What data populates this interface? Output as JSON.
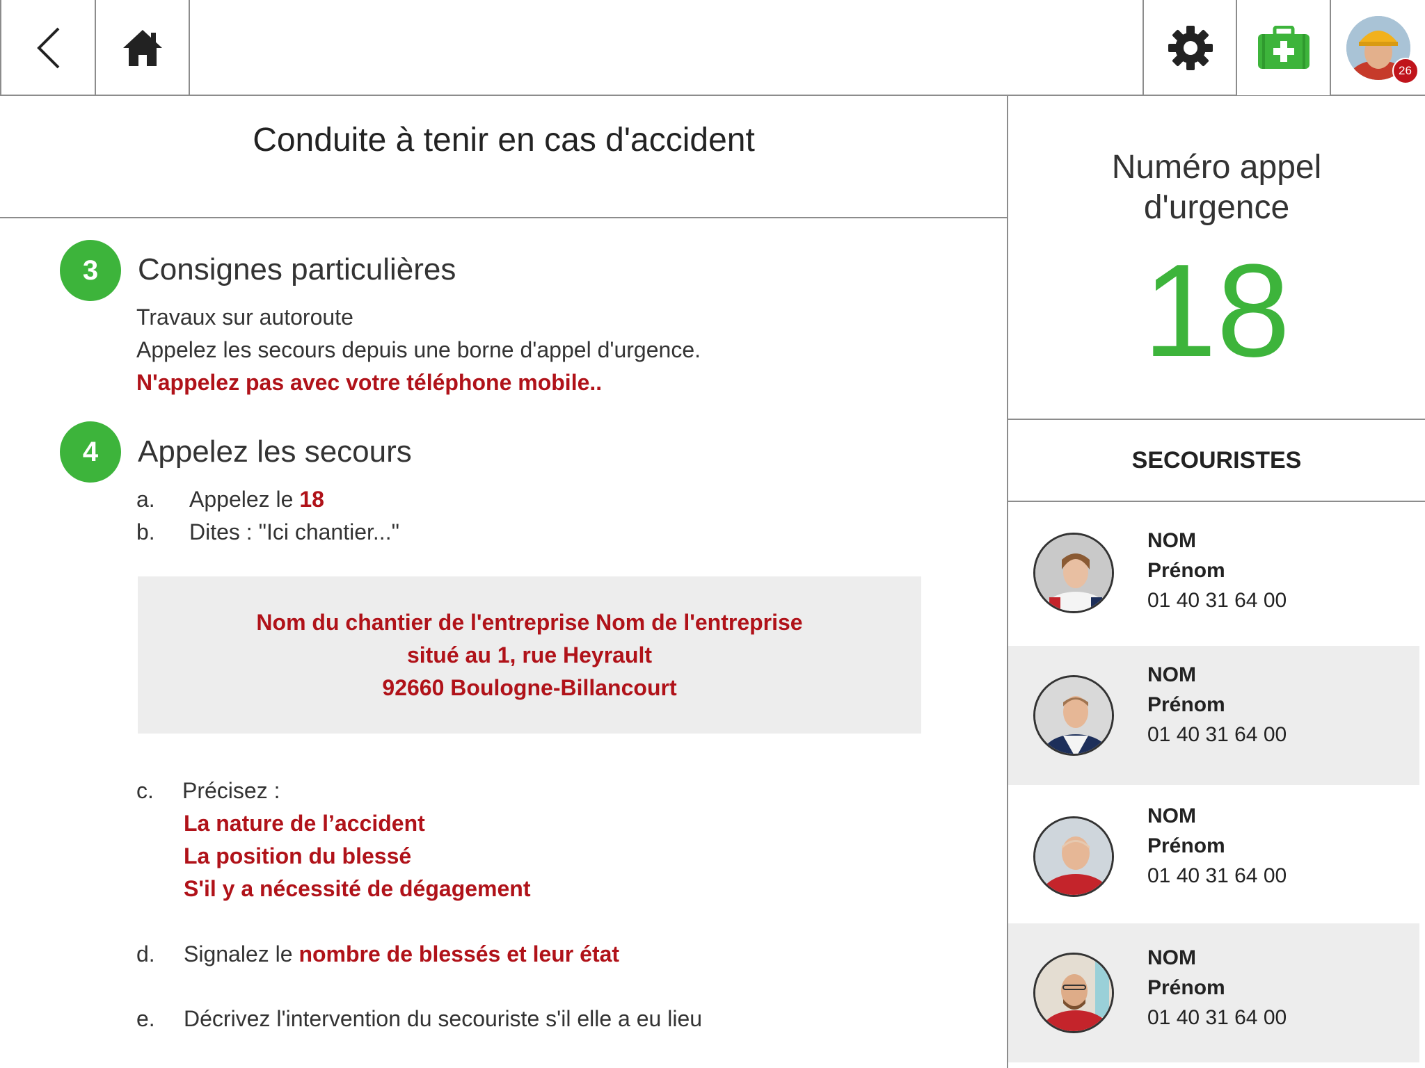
{
  "topbar": {
    "back_icon": "chevron-left-icon",
    "home_icon": "home-icon",
    "settings_icon": "gear-icon",
    "firstaid_icon": "first-aid-kit-icon",
    "notification_count": "26",
    "accent_color": "#3db43b"
  },
  "main": {
    "title": "Conduite à tenir en cas d'accident",
    "step3": {
      "number": "3",
      "title": "Consignes particulières",
      "line1": "Travaux sur autoroute",
      "line2": "Appelez les secours depuis une borne d'appel d'urgence.",
      "warning": "N'appelez pas avec votre téléphone mobile.."
    },
    "step4": {
      "number": "4",
      "title": "Appelez les secours",
      "a_label": "a.",
      "a_text": "Appelez le ",
      "a_number": "18",
      "b_label": "b.",
      "b_text": "Dites : \"Ici chantier...\"",
      "address_line1": "Nom du chantier de l'entreprise Nom de l'entreprise",
      "address_line2": "situé au 1, rue Heyrault",
      "address_line3": "92660 Boulogne-Billancourt",
      "c_label": "c.",
      "c_text": "Précisez :",
      "c_item1": "La nature de l’accident",
      "c_item2": "La position du blessé",
      "c_item3": "S'il y a nécessité de dégagement",
      "d_label": "d.",
      "d_text": "Signalez le ",
      "d_highlight": "nombre de blessés et leur état",
      "e_label": "e.",
      "e_text": "Décrivez l'intervention du secouriste s'il elle a eu lieu"
    }
  },
  "emergency": {
    "title_line1": "Numéro appel",
    "title_line2": "d'urgence",
    "number": "18"
  },
  "secouristes": {
    "header": "SECOURISTES",
    "items": [
      {
        "nom": "NOM",
        "prenom": "Prénom",
        "phone": "01 40 31 64 00"
      },
      {
        "nom": "NOM",
        "prenom": "Prénom",
        "phone": "01 40 31 64 00"
      },
      {
        "nom": "NOM",
        "prenom": "Prénom",
        "phone": "01 40 31 64 00"
      },
      {
        "nom": "NOM",
        "prenom": "Prénom",
        "phone": "01 40 31 64 00"
      }
    ]
  }
}
